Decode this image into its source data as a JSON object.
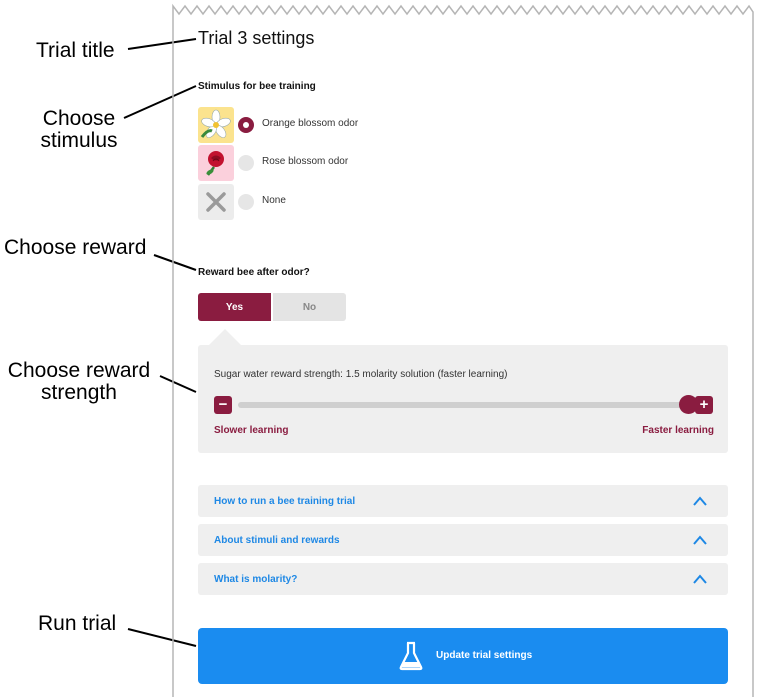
{
  "annotations": {
    "trial_title": "Trial title",
    "choose_stimulus_1": "Choose",
    "choose_stimulus_2": "stimulus",
    "choose_reward": "Choose reward",
    "choose_strength_1": "Choose reward",
    "choose_strength_2": "strength",
    "run_trial": "Run trial"
  },
  "panel": {
    "title": "Trial 3 settings",
    "stimulus": {
      "label": "Stimulus for bee training",
      "options": [
        {
          "label": "Orange blossom odor",
          "selected": true,
          "icon": "orange-blossom-icon"
        },
        {
          "label": "Rose blossom odor",
          "selected": false,
          "icon": "rose-icon"
        },
        {
          "label": "None",
          "selected": false,
          "icon": "x-icon"
        }
      ]
    },
    "reward": {
      "label": "Reward bee after odor?",
      "yes": "Yes",
      "no": "No",
      "selected": "Yes"
    },
    "strength": {
      "text": "Sugar water reward strength: 1.5 molarity solution (faster learning)",
      "min_label": "Slower learning",
      "max_label": "Faster learning",
      "value_fraction": 1.0
    },
    "accordions": [
      {
        "label": "How to run a bee training trial"
      },
      {
        "label": "About stimuli and rewards"
      },
      {
        "label": "What is molarity?"
      }
    ],
    "run_button": "Update trial settings"
  },
  "colors": {
    "accent": "#8a1c40",
    "link": "#1e88e5",
    "button": "#1a8cf0",
    "panel_bg": "#efefef"
  }
}
